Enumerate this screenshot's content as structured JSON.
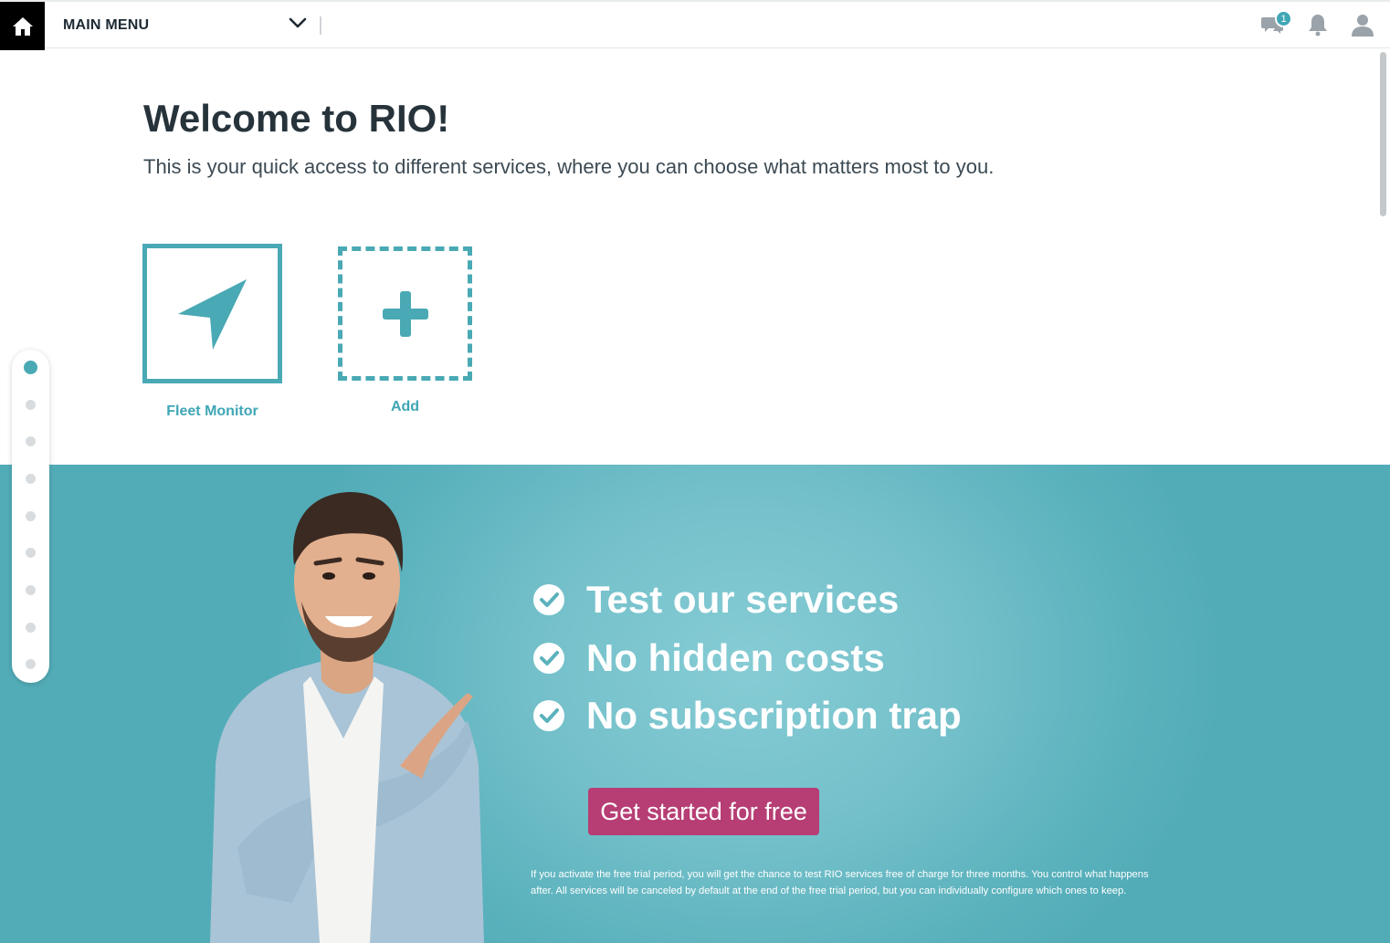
{
  "header": {
    "main_menu_label": "MAIN MENU",
    "icons": [
      "home-icon",
      "chevron-down-icon",
      "chat-icon",
      "bell-icon",
      "user-icon"
    ],
    "notification_count": "1"
  },
  "welcome": {
    "title": "Welcome to RIO!",
    "subtitle": "This is your quick access to different services, where you can choose what matters most to you."
  },
  "services": {
    "fleet_monitor_label": "Fleet Monitor",
    "add_label": "Add"
  },
  "pager": {
    "dot_count": 9,
    "active_index": 0
  },
  "promo": {
    "benefits": [
      "Test our services",
      "No hidden costs",
      "No subscription trap"
    ],
    "cta_label": "Get started for free",
    "disclaimer": "If you activate the free trial period, you will get the chance to test RIO services free of charge for three months. You control what happens after. All services will be canceled by default at the end of the free trial period, but you can individually configure which ones to keep."
  },
  "colors": {
    "accent": "#49a9b4",
    "cta": "#b63e74",
    "promo_bg": "#5bb2bd"
  }
}
